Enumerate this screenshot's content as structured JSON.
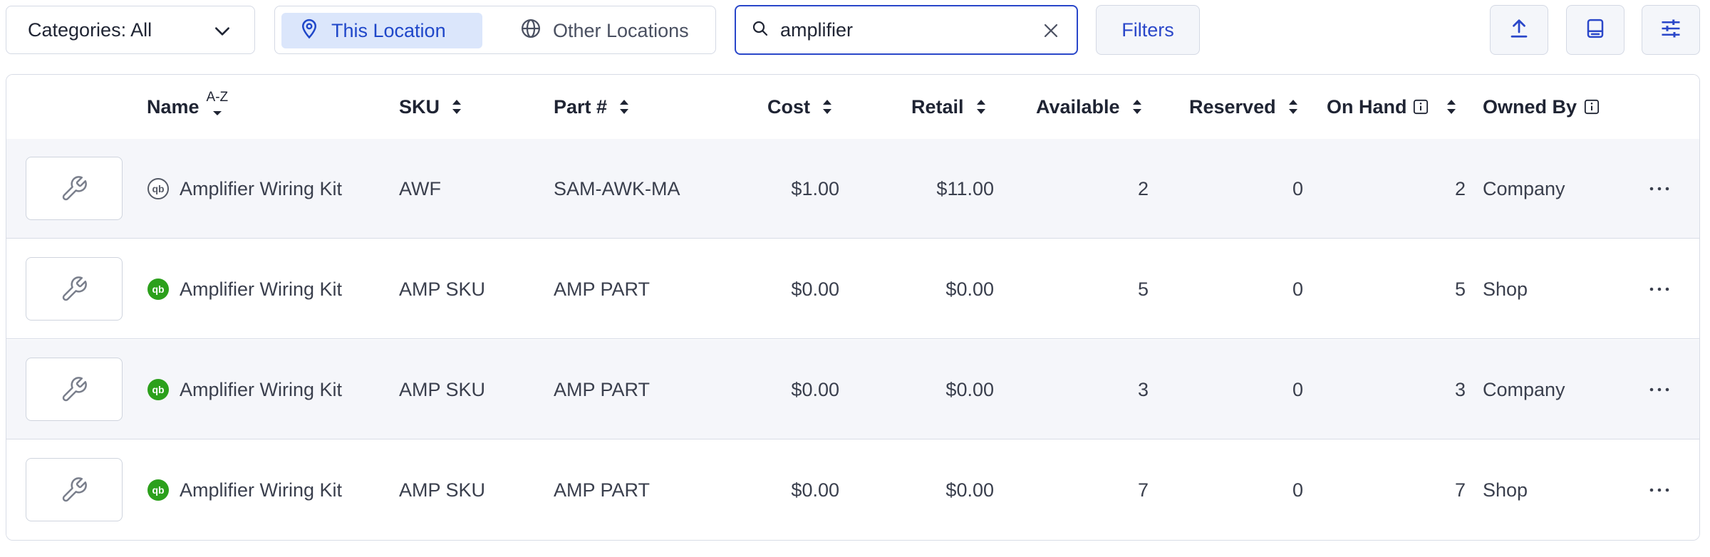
{
  "toolbar": {
    "category_dropdown": "Categories: All",
    "location_tabs": [
      "This Location",
      "Other Locations"
    ],
    "search_value": "amplifier",
    "filters_label": "Filters"
  },
  "colors": {
    "accent": "#2a47c9",
    "active_tab_bg": "#dbe6fb",
    "qb_green": "#2ca01c"
  },
  "table": {
    "columns": {
      "name": "Name",
      "sort_az": "A-Z",
      "sku": "SKU",
      "part": "Part #",
      "cost": "Cost",
      "retail": "Retail",
      "available": "Available",
      "reserved": "Reserved",
      "on_hand": "On Hand",
      "owned_by": "Owned By"
    },
    "rows": [
      {
        "qb_style": "outline",
        "name": "Amplifier Wiring Kit",
        "sku": "AWF",
        "part": "SAM-AWK-MA",
        "cost": "$1.00",
        "retail": "$11.00",
        "available": "2",
        "reserved": "0",
        "on_hand": "2",
        "owned_by": "Company"
      },
      {
        "qb_style": "green",
        "name": "Amplifier Wiring Kit",
        "sku": "AMP SKU",
        "part": "AMP PART",
        "cost": "$0.00",
        "retail": "$0.00",
        "available": "5",
        "reserved": "0",
        "on_hand": "5",
        "owned_by": "Shop"
      },
      {
        "qb_style": "green",
        "name": "Amplifier Wiring Kit",
        "sku": "AMP SKU",
        "part": "AMP PART",
        "cost": "$0.00",
        "retail": "$0.00",
        "available": "3",
        "reserved": "0",
        "on_hand": "3",
        "owned_by": "Company"
      },
      {
        "qb_style": "green",
        "name": "Amplifier Wiring Kit",
        "sku": "AMP SKU",
        "part": "AMP PART",
        "cost": "$0.00",
        "retail": "$0.00",
        "available": "7",
        "reserved": "0",
        "on_hand": "7",
        "owned_by": "Shop"
      }
    ]
  },
  "icons": {
    "dropdown": "chevron-down-icon",
    "this_location": "map-pin-icon",
    "other_locations": "globe-icon",
    "search": "search-icon",
    "clear": "close-icon",
    "export": "upload-icon",
    "scanner": "barcode-scanner-icon",
    "columns": "sliders-icon",
    "sort": "sort-icon",
    "info": "info-icon",
    "row_thumb": "wrench-icon",
    "quickbooks": "quickbooks-icon",
    "row_menu": "more-horizontal-icon"
  }
}
